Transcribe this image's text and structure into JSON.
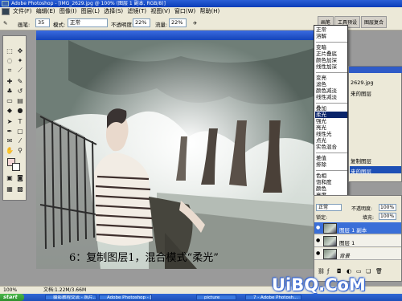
{
  "window": {
    "title": "Adobe Photoshop - [IMG_2629.jpg @ 100% (图层 1 副本, RGB/8)]"
  },
  "menu": [
    "文件(F)",
    "编辑(E)",
    "图像(I)",
    "图层(L)",
    "选择(S)",
    "滤镜(T)",
    "视图(V)",
    "窗口(W)",
    "帮助(H)"
  ],
  "options": {
    "brush_label": "画笔:",
    "brush_size": "35",
    "mode_label": "模式:",
    "mode_value": "正常",
    "opacity_label": "不透明度:",
    "opacity_value": "22%",
    "flow_label": "流量:",
    "flow_value": "22%"
  },
  "workspace_tabs": [
    "画笔",
    "工具预设",
    "图层复合"
  ],
  "blend_menu": {
    "groups": [
      [
        "正常",
        "溶解"
      ],
      [
        "变暗",
        "正片叠底",
        "颜色加深",
        "线性加深"
      ],
      [
        "变亮",
        "滤色",
        "颜色减淡",
        "线性减淡"
      ],
      [
        "叠加",
        "柔光",
        "强光",
        "亮光",
        "线性光",
        "点光",
        "实色混合"
      ],
      [
        "差值",
        "排除"
      ],
      [
        "色相",
        "饱和度",
        "颜色",
        "亮度"
      ]
    ],
    "selected": "柔光"
  },
  "history_panel": {
    "items": [
      "2629.jpg",
      "来的图层",
      "复制图层",
      "来的图层"
    ]
  },
  "layers": {
    "mode": "正常",
    "opacity_label": "不透明度:",
    "opacity": "100%",
    "lock_label": "锁定:",
    "fill_label": "填充:",
    "fill": "100%",
    "rows": [
      {
        "name": "图层 1 副本",
        "selected": true
      },
      {
        "name": "图层 1",
        "selected": false
      },
      {
        "name": "背景",
        "selected": false
      }
    ]
  },
  "caption": "6：复制图层1，混合模式“柔光”",
  "status": {
    "zoom": "100%",
    "doc": "文档:1.22M/3.66M"
  },
  "taskbar": {
    "start": "start",
    "tasks": [
      "摄影教程交流 - 照片...",
      "Adobe Photoshop - [I...",
      "picture"
    ],
    "right": "7 - Adobe Photosh..."
  },
  "watermark": "UiBQ.CoM"
}
